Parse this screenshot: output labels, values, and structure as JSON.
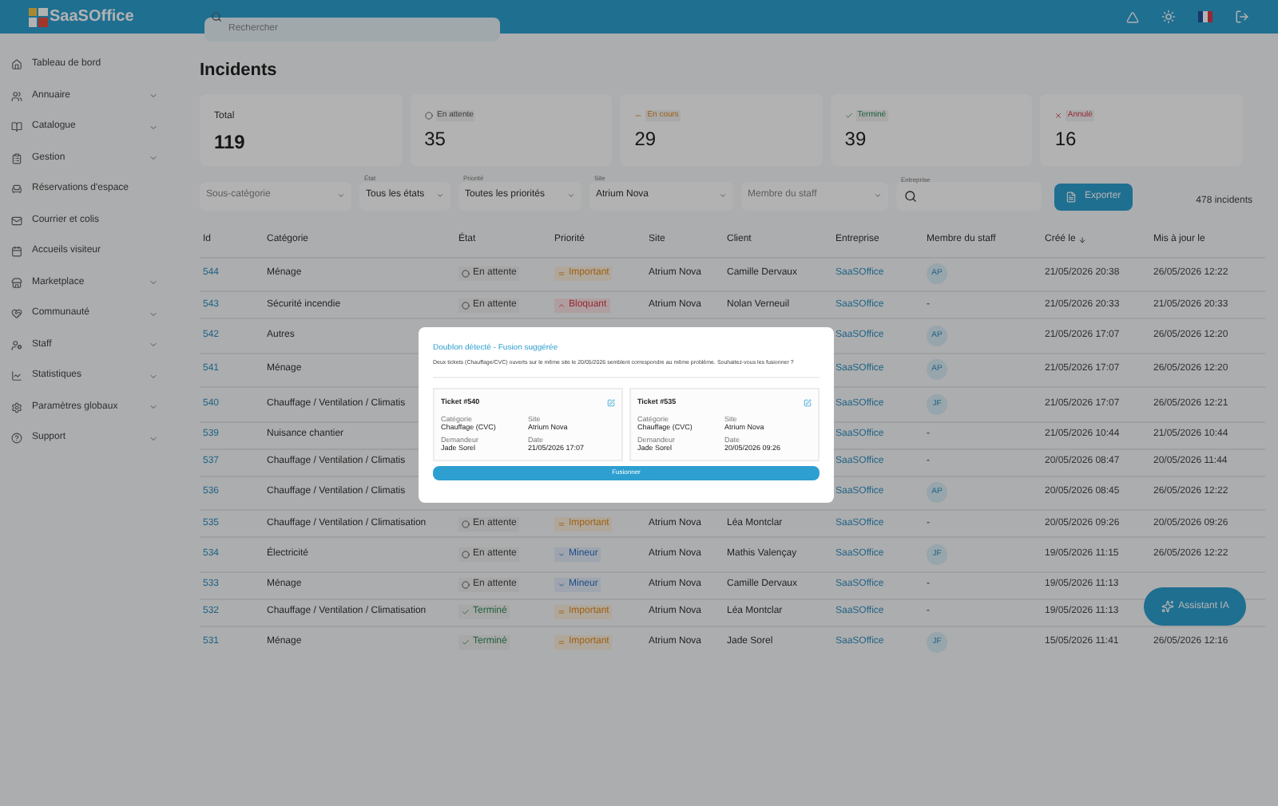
{
  "header": {
    "logo": "SaaSOffice",
    "search": {
      "placeholder": "Rechercher"
    }
  },
  "sidebar": {
    "items": [
      {
        "label": "Tableau de bord",
        "expandable": false
      },
      {
        "label": "Annuaire",
        "expandable": true
      },
      {
        "label": "Catalogue",
        "expandable": true
      },
      {
        "label": "Gestion",
        "expandable": true
      },
      {
        "label": "Réservations d'espace",
        "expandable": false
      },
      {
        "label": "Courrier et colis",
        "expandable": false
      },
      {
        "label": "Accueils visiteur",
        "expandable": false
      },
      {
        "label": "Marketplace",
        "expandable": true
      },
      {
        "label": "Communauté",
        "expandable": true
      },
      {
        "label": "Staff",
        "expandable": true
      },
      {
        "label": "Statistiques",
        "expandable": true
      },
      {
        "label": "Paramètres globaux",
        "expandable": true
      },
      {
        "label": "Support",
        "expandable": true
      }
    ]
  },
  "page": {
    "title": "Incidents"
  },
  "stats": [
    {
      "kind": "total",
      "label": "Total",
      "value": "119"
    },
    {
      "kind": "pending",
      "label": "En attente",
      "value": "35"
    },
    {
      "kind": "progress",
      "label": "En cours",
      "value": "29"
    },
    {
      "kind": "done",
      "label": "Terminé",
      "value": "39"
    },
    {
      "kind": "cancelled",
      "label": "Annulé",
      "value": "16"
    }
  ],
  "filters": [
    {
      "kind": "select",
      "placeholder": "Sous-catégorie"
    },
    {
      "kind": "select",
      "label": "État",
      "value": "Tous les états"
    },
    {
      "kind": "select",
      "label": "Priorité",
      "value": "Toutes les priorités"
    },
    {
      "kind": "select",
      "label": "Site",
      "value": "Atrium Nova"
    },
    {
      "kind": "select",
      "placeholder": "Membre du staff"
    },
    {
      "kind": "search",
      "label": "Entreprise"
    }
  ],
  "export_button": "Exporter",
  "count": "478 incidents",
  "table": {
    "columns": [
      "Id",
      "Catégorie",
      "État",
      "Priorité",
      "Site",
      "Client",
      "Entreprise",
      "Membre du staff",
      "Créé le",
      "Mis à jour le"
    ],
    "rows": [
      {
        "id": "544",
        "category": "Ménage",
        "status": {
          "kind": "pending",
          "label": "En attente"
        },
        "priority": {
          "kind": "important",
          "label": "Important"
        },
        "site": "Atrium Nova",
        "client": "Camille Dervaux",
        "company": "SaaSOffice",
        "staff": "AP",
        "created": "21/05/2026 20:38",
        "updated": "26/05/2026 12:22"
      },
      {
        "id": "543",
        "category": "Sécurité incendie",
        "status": {
          "kind": "pending",
          "label": "En attente"
        },
        "priority": {
          "kind": "blocking",
          "label": "Bloquant"
        },
        "site": "Atrium Nova",
        "client": "Nolan Verneuil",
        "company": "SaaSOffice",
        "staff": "-",
        "created": "21/05/2026 20:33",
        "updated": "21/05/2026 20:33"
      },
      {
        "id": "542",
        "category": "Autres",
        "company": "SaaSOffice",
        "staff": "AP",
        "created": "21/05/2026 17:07",
        "updated": "26/05/2026 12:20"
      },
      {
        "id": "541",
        "category": "Ménage",
        "company": "SaaSOffice",
        "staff": "AP",
        "created": "21/05/2026 17:07",
        "updated": "26/05/2026 12:20"
      },
      {
        "id": "540",
        "category": "Chauffage / Ventilation / Climatis",
        "company": "SaaSOffice",
        "staff": "JF",
        "created": "21/05/2026 17:07",
        "updated": "26/05/2026 12:21"
      },
      {
        "id": "539",
        "category": "Nuisance chantier",
        "company": "SaaSOffice",
        "staff": "-",
        "created": "21/05/2026 10:44",
        "updated": "21/05/2026 10:44"
      },
      {
        "id": "537",
        "category": "Chauffage / Ventilation / Climatis",
        "company": "SaaSOffice",
        "staff": "-",
        "created": "20/05/2026 08:47",
        "updated": "20/05/2026 11:44"
      },
      {
        "id": "536",
        "category": "Chauffage / Ventilation / Climatis",
        "company": "SaaSOffice",
        "staff": "AP",
        "created": "20/05/2026 08:45",
        "updated": "26/05/2026 12:22"
      },
      {
        "id": "535",
        "category": "Chauffage / Ventilation / Climatisation",
        "status": {
          "kind": "pending",
          "label": "En attente"
        },
        "priority": {
          "kind": "important",
          "label": "Important"
        },
        "site": "Atrium Nova",
        "client": "Léa Montclar",
        "company": "SaaSOffice",
        "staff": "-",
        "created": "20/05/2026 09:26",
        "updated": "20/05/2026 09:26"
      },
      {
        "id": "534",
        "category": "Électricité",
        "status": {
          "kind": "pending",
          "label": "En attente"
        },
        "priority": {
          "kind": "minor",
          "label": "Mineur"
        },
        "site": "Atrium Nova",
        "client": "Mathis Valençay",
        "company": "SaaSOffice",
        "staff": "JF",
        "created": "19/05/2026 11:15",
        "updated": "26/05/2026 12:22"
      },
      {
        "id": "533",
        "category": "Ménage",
        "status": {
          "kind": "pending",
          "label": "En attente"
        },
        "priority": {
          "kind": "minor",
          "label": "Mineur"
        },
        "site": "Atrium Nova",
        "client": "Camille Dervaux",
        "company": "SaaSOffice",
        "staff": "-",
        "created": "19/05/2026 11:13"
      },
      {
        "id": "532",
        "category": "Chauffage / Ventilation / Climatisation",
        "status": {
          "kind": "done",
          "label": "Terminé"
        },
        "priority": {
          "kind": "important",
          "label": "Important"
        },
        "site": "Atrium Nova",
        "client": "Léa Montclar",
        "company": "SaaSOffice",
        "staff": "-",
        "created": "19/05/2026 11:13"
      },
      {
        "id": "531",
        "category": "Ménage",
        "status": {
          "kind": "done",
          "label": "Terminé"
        },
        "priority": {
          "kind": "important",
          "label": "Important"
        },
        "site": "Atrium Nova",
        "client": "Jade Sorel",
        "company": "SaaSOffice",
        "staff": "JF",
        "created": "15/05/2026 11:41",
        "updated": "26/05/2026 12:16"
      }
    ]
  },
  "assistant_button": "Assistant IA",
  "dialog": {
    "title": "Doublon détecté - Fusion suggérée",
    "text": "Deux tickets (Chauffage/CVC) ouverts sur le même site le 20/05/2026 semblent correspondre au même problème. Souhaitez-vous les fusionner ?",
    "tickets": [
      {
        "title": "Ticket #540",
        "fields": [
          {
            "label": "Catégorie",
            "value": "Chauffage (CVC)"
          },
          {
            "label": "Site",
            "value": "Atrium Nova"
          },
          {
            "label": "Demandeur",
            "value": "Jade Sorel"
          },
          {
            "label": "Date",
            "value": "21/05/2026 17:07"
          }
        ]
      },
      {
        "title": "Ticket #535",
        "fields": [
          {
            "label": "Catégorie",
            "value": "Chauffage (CVC)"
          },
          {
            "label": "Site",
            "value": "Atrium Nova"
          },
          {
            "label": "Demandeur",
            "value": "Jade Sorel"
          },
          {
            "label": "Date",
            "value": "20/05/2026 09:26"
          }
        ]
      }
    ],
    "button": "Fusionner"
  }
}
